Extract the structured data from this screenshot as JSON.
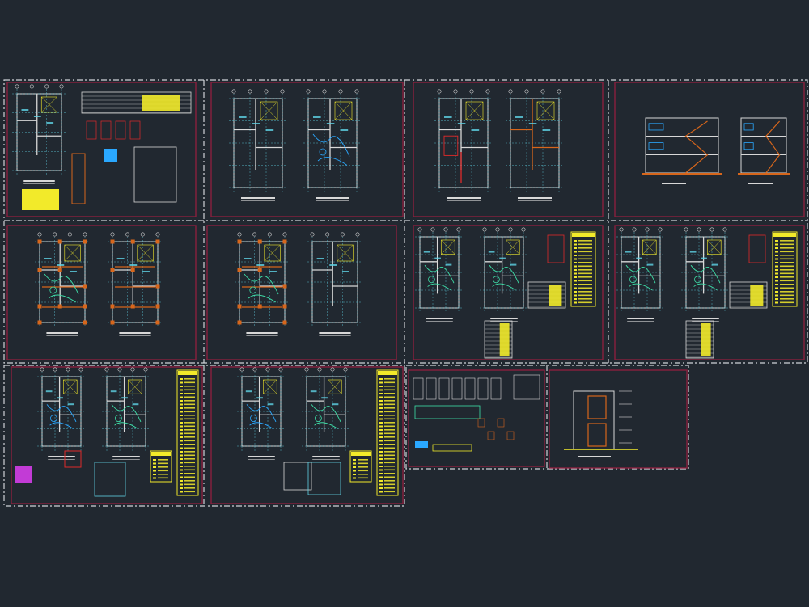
{
  "colors": {
    "background": "#212830",
    "sheet_border": "#8a1f3e",
    "frame_dash": "#cfd3d8",
    "wall": "#d8d8d8",
    "structure": "#d7661b",
    "annotation": "#5fd3e6",
    "electrical": "#3ee0a8",
    "plumbing": "#2aa8ff",
    "legend": "#f2ea2a",
    "accent_red": "#e02a2a",
    "accent_magenta": "#c23bd6"
  },
  "sheets": [
    {
      "id": "sheet-site-plan",
      "content": "site-plan-with-details",
      "has_legend": false
    },
    {
      "id": "sheet-architecture-1",
      "content": "two-floor-plans",
      "has_legend": false
    },
    {
      "id": "sheet-architecture-2",
      "content": "two-floor-plans-red",
      "has_legend": false
    },
    {
      "id": "sheet-sections",
      "content": "two-sections",
      "has_legend": false
    },
    {
      "id": "sheet-structure-1",
      "content": "two-structural-plans",
      "has_legend": false
    },
    {
      "id": "sheet-structure-2",
      "content": "two-structural-plans",
      "has_legend": false
    },
    {
      "id": "sheet-electrical-1",
      "content": "installation-plans-with-legend",
      "has_legend": true
    },
    {
      "id": "sheet-electrical-2",
      "content": "installation-plans-with-legend",
      "has_legend": true
    },
    {
      "id": "sheet-sanitary-1",
      "content": "installation-plans-with-legend",
      "has_legend": true
    },
    {
      "id": "sheet-sanitary-2",
      "content": "installation-plans-with-legend",
      "has_legend": true
    },
    {
      "id": "sheet-details",
      "content": "construction-details",
      "has_legend": false
    },
    {
      "id": "sheet-elevation",
      "content": "front-elevation",
      "has_legend": false
    }
  ]
}
